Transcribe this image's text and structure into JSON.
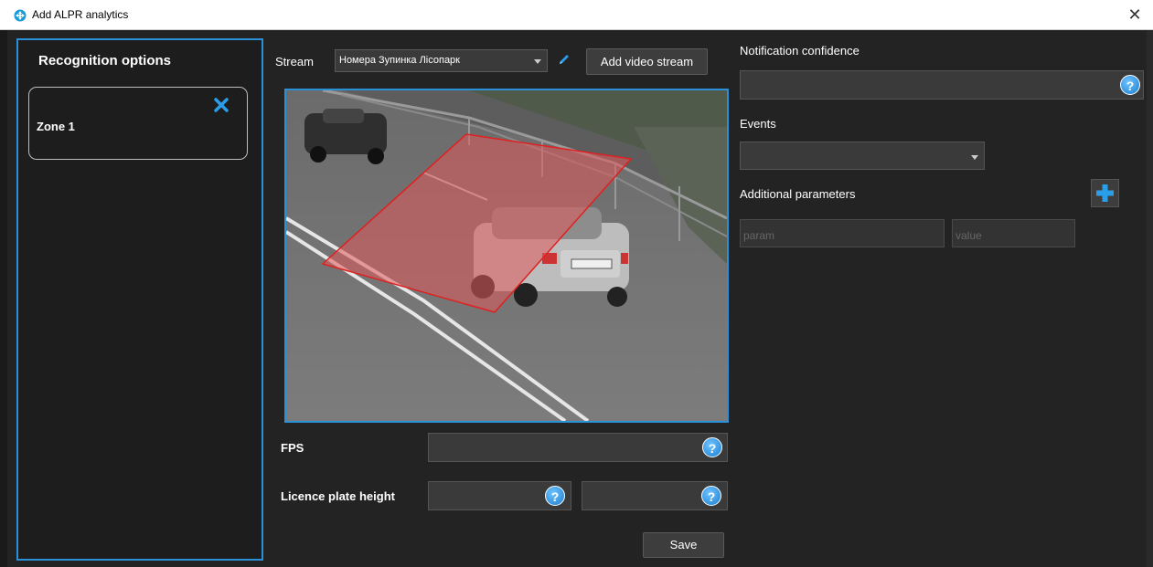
{
  "window": {
    "title": "Add ALPR analytics",
    "close_glyph": "✕",
    "icon": "alpr-app-icon"
  },
  "left_panel": {
    "heading": "Recognition options",
    "zones": [
      {
        "label": "Zone 1",
        "remove_icon": "close-x-icon"
      }
    ]
  },
  "stream": {
    "label": "Stream",
    "selected": "Номера Зупинка Лісопарк",
    "edit_icon": "pencil-icon",
    "add_button": "Add video stream"
  },
  "form": {
    "fps_label": "FPS",
    "fps_value": "",
    "plate_height_label": "Licence plate height",
    "plate_min_value": "",
    "plate_max_value": "",
    "help_glyph": "?",
    "save_button": "Save"
  },
  "right_panel": {
    "notification_label": "Notification confidence",
    "notification_value": "",
    "events_label": "Events",
    "events_selected": "",
    "additional_label": "Additional parameters",
    "add_icon": "plus-icon",
    "param_placeholder": "param",
    "value_placeholder": "value"
  },
  "colors": {
    "accent_blue": "#2a90d8",
    "background": "#232323",
    "zone_fill": "#e05a5a",
    "zone_stroke": "#e02020"
  }
}
